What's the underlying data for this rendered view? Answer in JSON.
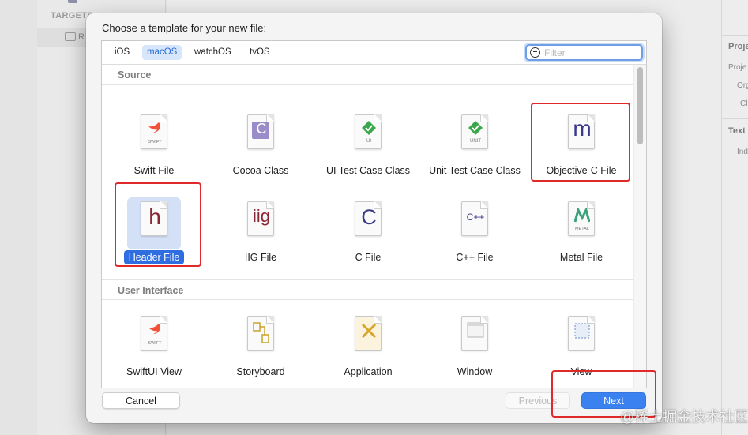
{
  "background": {
    "targets_label": "TARGETS",
    "target_item": "R",
    "inspector": {
      "section1": "Proje",
      "row1": "Proje",
      "row2": "Org",
      "row3": "Cl",
      "section2": "Text",
      "row4": "Ind"
    }
  },
  "dialog": {
    "title": "Choose a template for your new file:",
    "platform_tabs": [
      {
        "label": "iOS",
        "active": false
      },
      {
        "label": "macOS",
        "active": true
      },
      {
        "label": "watchOS",
        "active": false
      },
      {
        "label": "tvOS",
        "active": false
      }
    ],
    "filter": {
      "placeholder": "Filter",
      "value": ""
    },
    "sections": [
      {
        "title": "Source",
        "templates": [
          {
            "label": "Swift File",
            "icon": "swift-icon",
            "badge": "SWIFT"
          },
          {
            "label": "Cocoa Class",
            "icon": "cocoa-class-icon",
            "glyph": "C"
          },
          {
            "label": "UI Test Case Class",
            "icon": "ui-test-icon",
            "badge": "UI"
          },
          {
            "label": "Unit Test Case Class",
            "icon": "unit-test-icon",
            "badge": "UNIT"
          },
          {
            "label": "Objective-C File",
            "icon": "objc-icon",
            "glyph": "m"
          },
          {
            "label": "Header File",
            "icon": "header-icon",
            "glyph": "h",
            "selected": true
          },
          {
            "label": "IIG File",
            "icon": "iig-icon",
            "glyph": "iig"
          },
          {
            "label": "C File",
            "icon": "c-file-icon",
            "glyph": "C"
          },
          {
            "label": "C++ File",
            "icon": "cpp-file-icon",
            "glyph": "C++"
          },
          {
            "label": "Metal File",
            "icon": "metal-icon",
            "badge": "METAL"
          }
        ]
      },
      {
        "title": "User Interface",
        "templates": [
          {
            "label": "SwiftUI View",
            "icon": "swiftui-icon",
            "badge": "SWIFT"
          },
          {
            "label": "Storyboard",
            "icon": "storyboard-icon"
          },
          {
            "label": "Application",
            "icon": "application-icon"
          },
          {
            "label": "Window",
            "icon": "window-icon"
          },
          {
            "label": "View",
            "icon": "view-icon"
          }
        ]
      }
    ],
    "buttons": {
      "cancel": "Cancel",
      "previous": "Previous",
      "next": "Next"
    }
  },
  "colors": {
    "accent": "#2f6ee0",
    "highlight": "#e02a2a",
    "swift": "#f05138"
  },
  "watermark": "@稀土掘金技术社区"
}
